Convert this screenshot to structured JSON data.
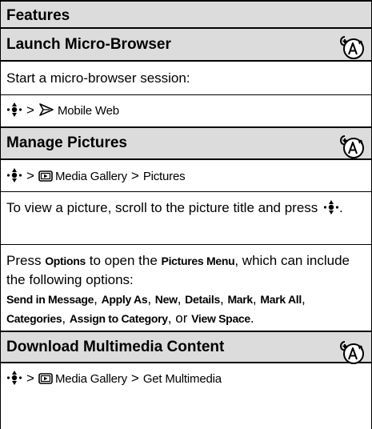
{
  "header": {
    "title": "Features"
  },
  "sections": [
    {
      "title": "Launch Micro-Browser",
      "body": "Start a micro-browser session:",
      "path_item": "Mobile Web"
    },
    {
      "title": "Manage Pictures",
      "path_item1": "Media Gallery",
      "path_item2": "Pictures",
      "instruction": "To view a picture, scroll to the picture title and press",
      "press_prefix": "Press",
      "options_label": "Options",
      "press_mid": "to open the",
      "menu_label": "Pictures Menu",
      "press_suffix": ", which can include the following options:",
      "options_list": [
        "Send in Message",
        "Apply As",
        "New",
        "Details",
        "Mark",
        "Mark All",
        "Categories",
        "Assign to Category",
        "View Space"
      ],
      "list_joiner_last": "or"
    },
    {
      "title": "Download Multimedia Content",
      "path_item1": "Media Gallery",
      "path_item2": "Get Multimedia"
    }
  ],
  "separators": {
    "gt": ">",
    "comma": ",",
    "period": "."
  },
  "icons": {
    "nav": "navigation-key-icon",
    "web": "browser-icon",
    "media": "media-gallery-icon",
    "operator": "network-operator-feature-icon"
  }
}
